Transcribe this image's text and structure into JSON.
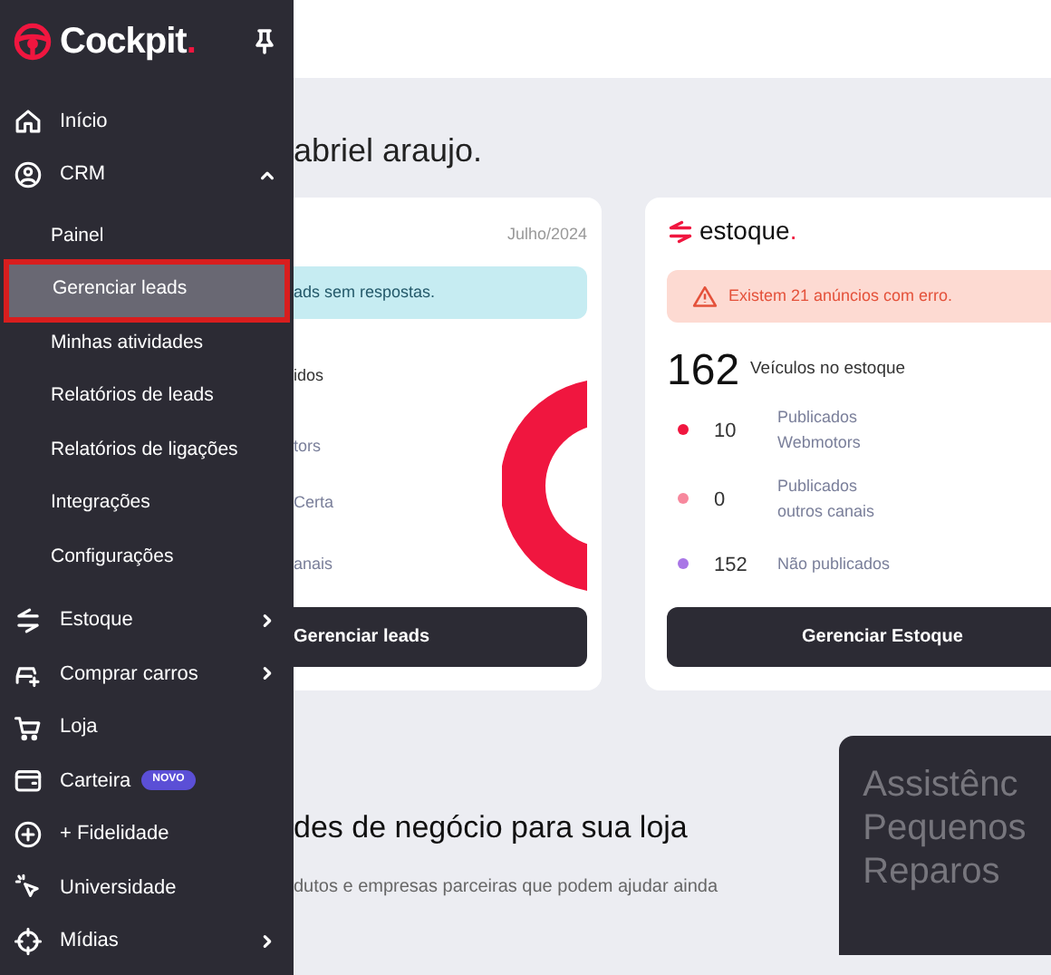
{
  "sidebar": {
    "logo": {
      "text": "Cockpit",
      "dot": "."
    },
    "items": [
      {
        "label": "Início",
        "submenu": false
      },
      {
        "label": "CRM",
        "submenu": true,
        "expanded": true,
        "children": [
          {
            "label": "Painel",
            "selected": false
          },
          {
            "label": "Gerenciar leads",
            "selected": true
          },
          {
            "label": "Minhas atividades",
            "selected": false
          },
          {
            "label": "Relatórios de leads",
            "selected": false
          },
          {
            "label": "Relatórios de ligações",
            "selected": false
          },
          {
            "label": "Integrações",
            "selected": false
          },
          {
            "label": "Configurações",
            "selected": false
          }
        ]
      },
      {
        "label": "Estoque",
        "submenu": true,
        "expanded": false
      },
      {
        "label": "Comprar carros",
        "submenu": true,
        "expanded": false
      },
      {
        "label": "Loja",
        "submenu": false
      },
      {
        "label": "Carteira",
        "submenu": false,
        "badge": "NOVO"
      },
      {
        "label": "+ Fidelidade",
        "submenu": false
      },
      {
        "label": "Universidade",
        "submenu": false
      },
      {
        "label": "Mídias",
        "submenu": true,
        "expanded": false
      }
    ]
  },
  "greeting": "abriel araujo.",
  "leads_card": {
    "period": "Julho/2024",
    "alert": "ads sem respostas.",
    "rows": [
      "idos",
      "tors",
      "Certa",
      "anais"
    ],
    "button": "Gerenciar leads"
  },
  "stock_card": {
    "logo": {
      "text": "estoque",
      "dot": "."
    },
    "alert": "Existem 21 anúncios com erro.",
    "total": "162",
    "total_label": "Veículos no estoque",
    "rows": [
      {
        "value": "10",
        "label": "Publicados Webmotors",
        "color": "#f0163f"
      },
      {
        "value": "0",
        "label": "Publicados outros canais",
        "color": "#f7889d"
      },
      {
        "value": "152",
        "label": "Não publicados",
        "color": "#a976e6"
      }
    ],
    "button": "Gerenciar Estoque"
  },
  "opportunities": {
    "title": "des de negócio para sua loja",
    "subtitle": "dutos e empresas parceiras que podem ajudar ainda"
  },
  "promo_card": {
    "title_lines": [
      "Assistênc",
      "Pequenos",
      "Reparos"
    ]
  }
}
